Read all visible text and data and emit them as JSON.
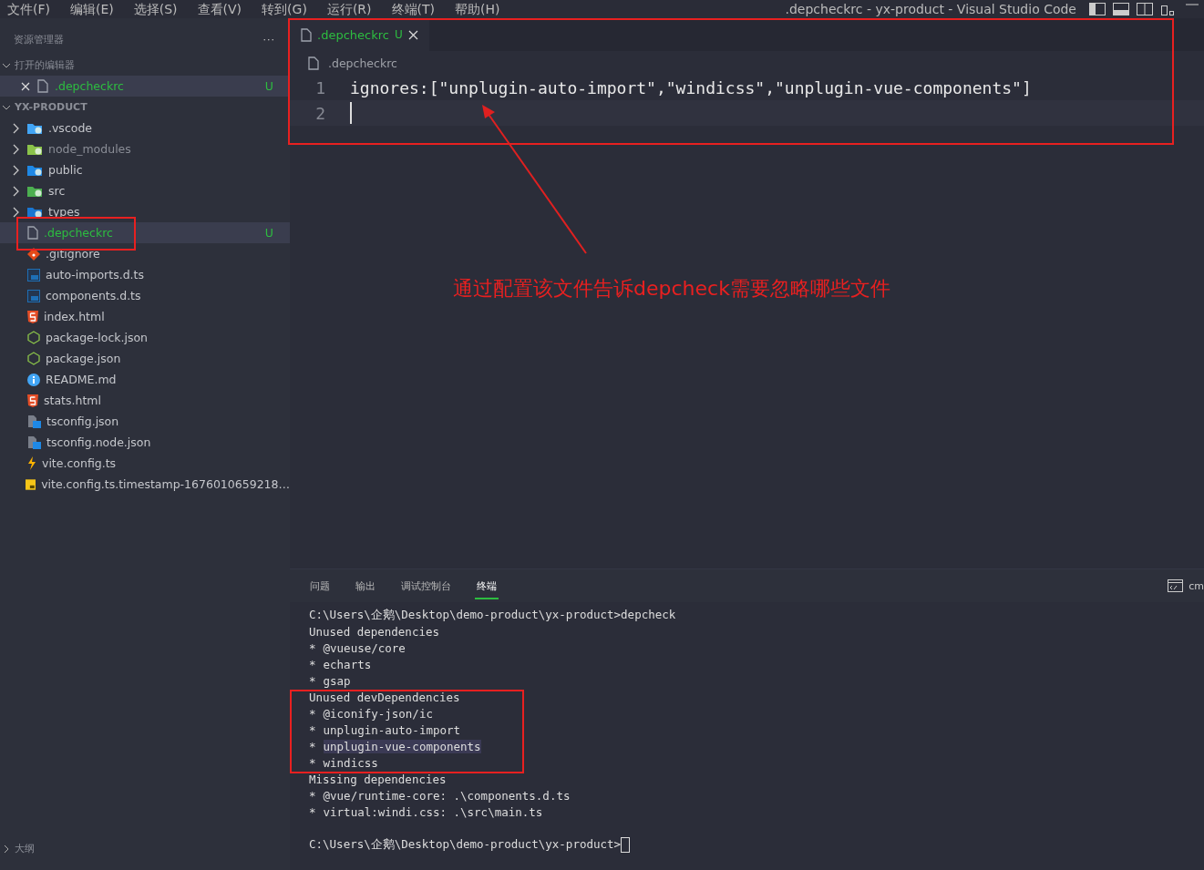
{
  "menu": [
    "文件(F)",
    "编辑(E)",
    "选择(S)",
    "查看(V)",
    "转到(G)",
    "运行(R)",
    "终端(T)",
    "帮助(H)"
  ],
  "window": {
    "title": ".depcheckrc - yx-product - Visual Studio Code"
  },
  "sidebar": {
    "title": "资源管理器",
    "more": "···",
    "open_editors": {
      "title": "打开的编辑器",
      "expanded": true,
      "items": [
        {
          "name": ".depcheckrc",
          "status": "U",
          "selected": true
        }
      ]
    },
    "project": {
      "title": "YX-PRODUCT",
      "expanded": true,
      "items": [
        {
          "name": ".vscode",
          "kind": "vscode",
          "expanded": false,
          "selected": false
        },
        {
          "name": "node_modules",
          "kind": "node",
          "expanded": false,
          "ignored": true,
          "selected": false
        },
        {
          "name": "public",
          "kind": "public",
          "expanded": false,
          "selected": false
        },
        {
          "name": "src",
          "kind": "src",
          "expanded": false,
          "selected": false
        },
        {
          "name": "types",
          "kind": "types",
          "expanded": false,
          "selected": false
        },
        {
          "name": ".depcheckrc",
          "kind": "file",
          "status": "U",
          "selected": true
        },
        {
          "name": ".gitignore",
          "kind": "git",
          "selected": false
        },
        {
          "name": "auto-imports.d.ts",
          "kind": "ts",
          "selected": false
        },
        {
          "name": "components.d.ts",
          "kind": "ts",
          "selected": false
        },
        {
          "name": "index.html",
          "kind": "html",
          "selected": false
        },
        {
          "name": "package-lock.json",
          "kind": "nodejs",
          "selected": false
        },
        {
          "name": "package.json",
          "kind": "nodejs",
          "selected": false
        },
        {
          "name": "README.md",
          "kind": "info",
          "selected": false
        },
        {
          "name": "stats.html",
          "kind": "html",
          "selected": false
        },
        {
          "name": "tsconfig.json",
          "kind": "tsconfig",
          "selected": false
        },
        {
          "name": "tsconfig.node.json",
          "kind": "tsconfig",
          "selected": false
        },
        {
          "name": "vite.config.ts",
          "kind": "vite",
          "selected": false
        },
        {
          "name": "vite.config.ts.timestamp-1676010659218…",
          "kind": "js",
          "selected": false
        }
      ]
    },
    "bottom_sections": [
      {
        "title": "大纲",
        "expanded": false
      }
    ]
  },
  "editor": {
    "tabs": [
      {
        "label": ".depcheckrc",
        "status": "U",
        "selected": true
      }
    ],
    "breadcrumb": ".depcheckrc",
    "lines": [
      {
        "number": "1",
        "text": "ignores:[\"unplugin-auto-import\",\"windicss\",\"unplugin-vue-components\"]"
      },
      {
        "number": "2",
        "cursor": true
      }
    ]
  },
  "annotation": {
    "text": "通过配置该文件告诉depcheck需要忽略哪些文件"
  },
  "panel": {
    "tabs": [
      {
        "label": "问题",
        "selected": false
      },
      {
        "label": "输出",
        "selected": false
      },
      {
        "label": "调试控制台",
        "selected": false
      },
      {
        "label": "终端",
        "selected": true
      }
    ],
    "shell": "cm",
    "terminal": [
      {
        "text": "C:\\Users\\企鹅\\Desktop\\demo-product\\yx-product>depcheck"
      },
      {
        "text": "Unused dependencies"
      },
      {
        "bullet": "*",
        "text": "@vueuse/core"
      },
      {
        "bullet": "*",
        "text": "echarts"
      },
      {
        "bullet": "*",
        "text": "gsap"
      },
      {
        "text": "Unused devDependencies"
      },
      {
        "bullet": "*",
        "text": "@iconify-json/ic"
      },
      {
        "bullet": "*",
        "text": "unplugin-auto-import"
      },
      {
        "bullet": "*",
        "text": "unplugin-vue-components",
        "selected": true
      },
      {
        "bullet": "*",
        "text": "windicss"
      },
      {
        "text": "Missing dependencies"
      },
      {
        "bullet": "*",
        "text": "@vue/runtime-core: .\\components.d.ts"
      },
      {
        "bullet": "*",
        "text": "virtual:windi.css: .\\src\\main.ts"
      },
      {
        "text": "C:\\Users\\企鹅\\Desktop\\demo-product\\yx-product>",
        "cursor": true
      }
    ]
  }
}
